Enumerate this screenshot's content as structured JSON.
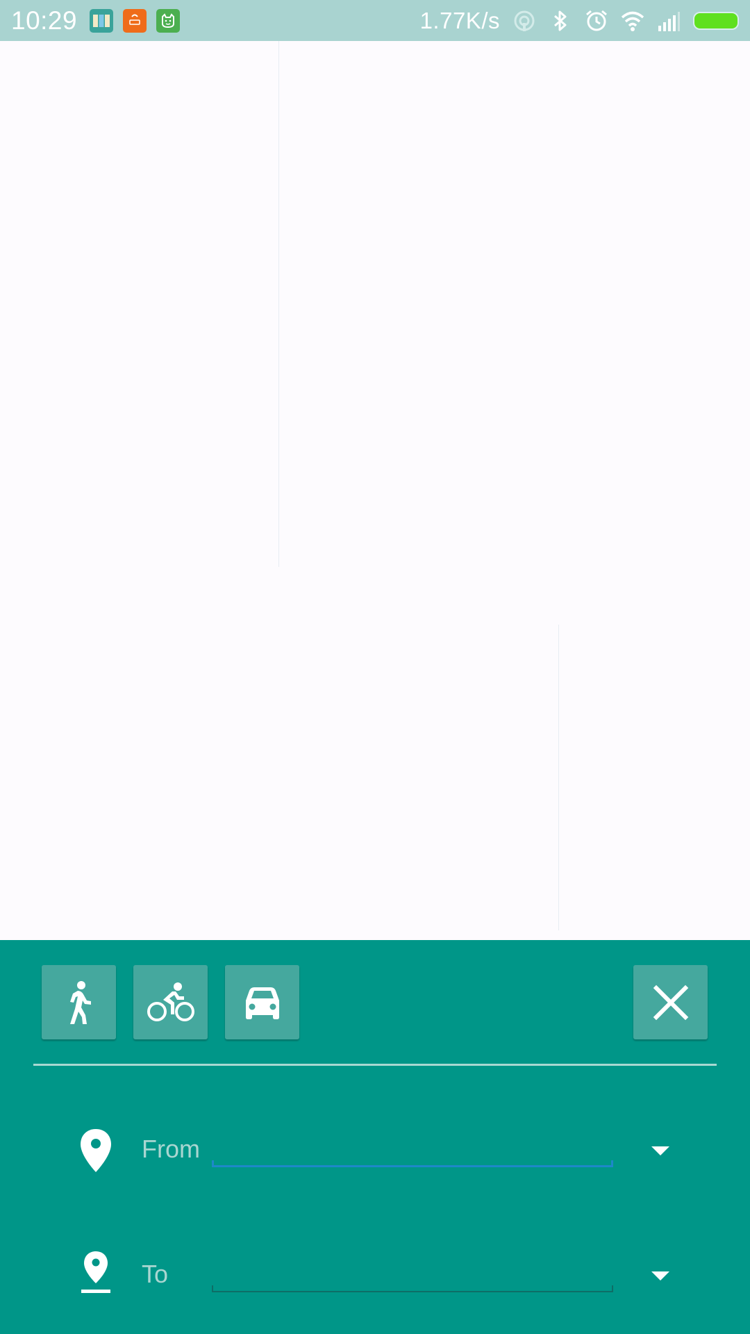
{
  "status_bar": {
    "time": "10:29",
    "network_speed": "1.77K/s",
    "notification_icons": [
      "maps-app-icon",
      "mi-store-icon",
      "cat-app-icon"
    ],
    "system_icons": [
      "hotspot-icon",
      "bluetooth-icon",
      "alarm-icon",
      "wifi-icon",
      "signal-icon",
      "battery-icon"
    ],
    "battery_color": "#5fe01f",
    "background_color": "#a9d3d0"
  },
  "panel": {
    "background_color": "#009688",
    "button_color": "#45a89e",
    "modes": [
      {
        "name": "walking",
        "icon": "walk-icon"
      },
      {
        "name": "cycling",
        "icon": "bike-icon"
      },
      {
        "name": "driving",
        "icon": "car-icon"
      }
    ],
    "close_icon": "close-icon",
    "from": {
      "label": "From",
      "value": "",
      "icon": "location-pin-icon"
    },
    "to": {
      "label": "To",
      "value": "",
      "icon": "destination-pin-icon"
    },
    "accent_color": "#1e88c9"
  }
}
